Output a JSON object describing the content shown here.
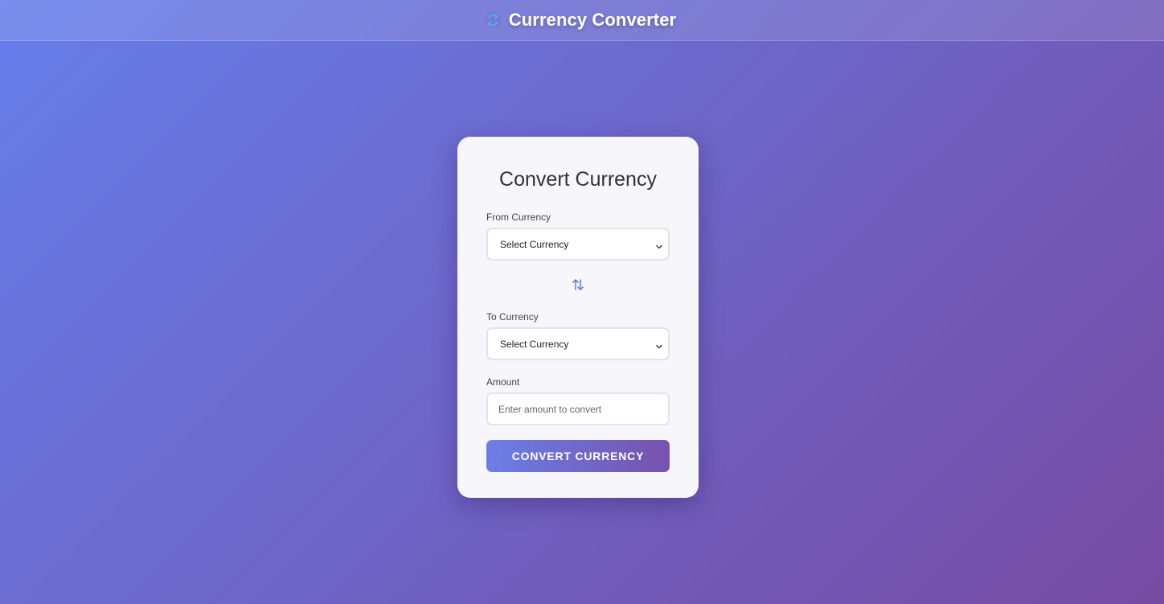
{
  "header": {
    "title": "Currency Converter",
    "logo_icon": "currency-exchange-icon"
  },
  "card": {
    "title": "Convert Currency",
    "from": {
      "label": "From Currency",
      "selected": "Select Currency"
    },
    "swap_icon": "swap-vertical-icon",
    "to": {
      "label": "To Currency",
      "selected": "Select Currency"
    },
    "amount": {
      "label": "Amount",
      "placeholder": "Enter amount to convert",
      "value": ""
    },
    "convert_button": "CONVERT CURRENCY"
  },
  "colors": {
    "background_start": "#667eea",
    "background_end": "#764ba2",
    "card_background": "#f7f6fb",
    "accent": "#6a7fe6"
  }
}
